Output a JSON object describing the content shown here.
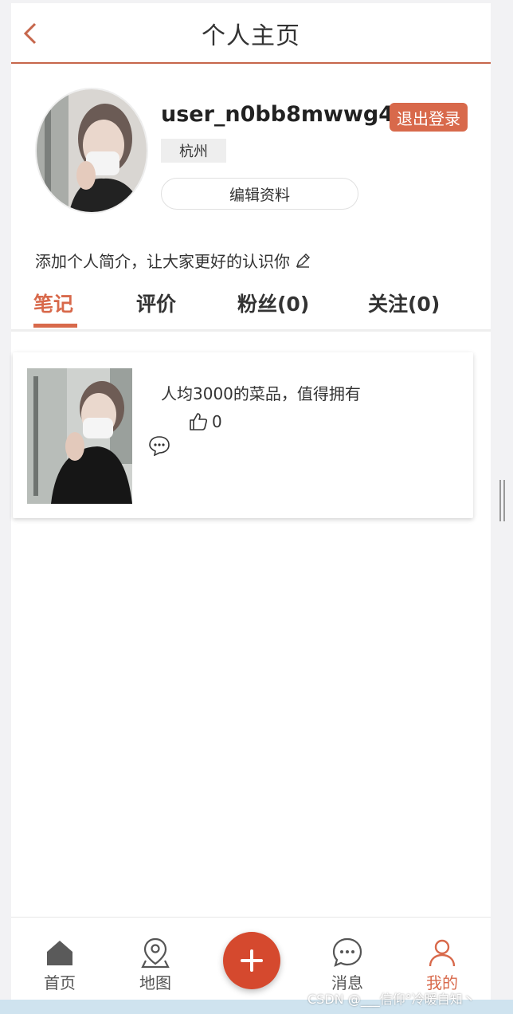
{
  "header": {
    "title": "个人主页"
  },
  "profile": {
    "username": "user_n0bb8mwwg4",
    "logout_label": "退出登录",
    "city": "杭州",
    "edit_label": "编辑资料",
    "bio_placeholder": "添加个人简介，让大家更好的认识你"
  },
  "tabs": [
    {
      "label": "笔记",
      "active": true
    },
    {
      "label": "评价",
      "active": false
    },
    {
      "label": "粉丝(0)",
      "active": false
    },
    {
      "label": "关注(0)",
      "active": false
    }
  ],
  "notes": [
    {
      "title": "人均3000的菜品，值得拥有",
      "likes": "0"
    }
  ],
  "bottom_nav": [
    {
      "label": "首页",
      "icon": "home-icon",
      "active": false
    },
    {
      "label": "地图",
      "icon": "map-pin-icon",
      "active": false
    },
    {
      "label": "",
      "icon": "plus-icon",
      "active": false
    },
    {
      "label": "消息",
      "icon": "chat-icon",
      "active": false
    },
    {
      "label": "我的",
      "icon": "user-icon",
      "active": true
    }
  ],
  "watermark": "CSDN @___信仰°冷暖自知丶",
  "colors": {
    "accent": "#d8694b",
    "add_button": "#d5492e"
  }
}
